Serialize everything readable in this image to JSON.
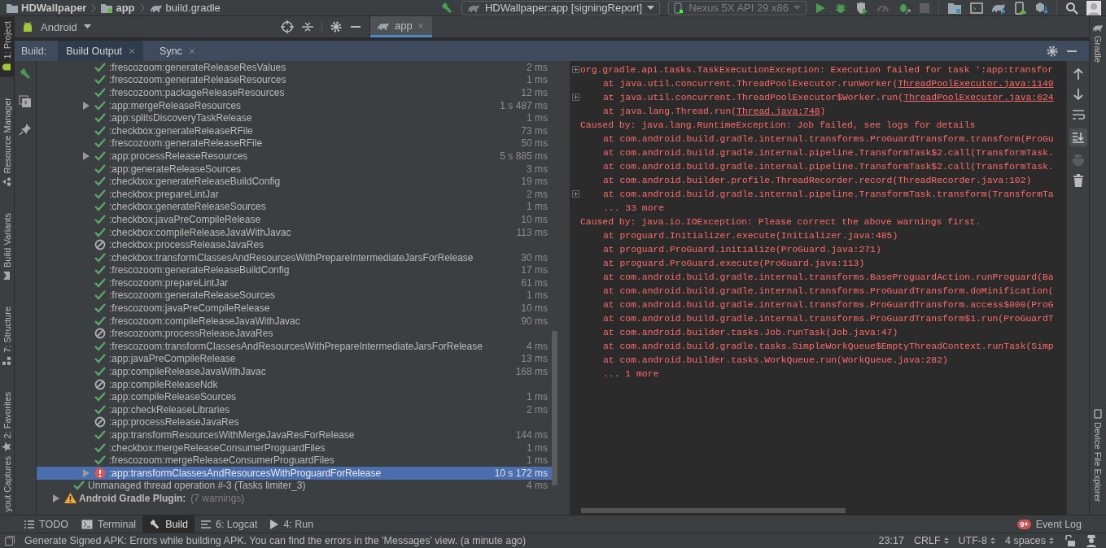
{
  "navbar": {
    "breadcrumbs": [
      {
        "label": "HDWallpaper",
        "kind": "project"
      },
      {
        "label": "app",
        "kind": "module"
      },
      {
        "label": "build.gradle",
        "kind": "file"
      }
    ],
    "run_config": "HDWallpaper:app [signingReport]",
    "device": "Nexus 5X API 29 x86"
  },
  "left_stripe": [
    {
      "label": "1: Project",
      "selected": true
    },
    {
      "label": "Resource Manager",
      "selected": false
    },
    {
      "label": "Build Variants",
      "selected": false
    },
    {
      "label": "7: Structure",
      "selected": false
    },
    {
      "label": "2: Favorites",
      "selected": false
    },
    {
      "label": "yout Captures",
      "selected": false
    }
  ],
  "right_stripe": [
    {
      "label": "Gradle"
    },
    {
      "label": "Device File Explorer"
    }
  ],
  "project_view": {
    "mode": "Android"
  },
  "editor_tabs": [
    {
      "label": "app",
      "selected": true
    }
  ],
  "build_panel": {
    "title": "Build:",
    "tabs": [
      {
        "label": "Build Output",
        "selected": true
      },
      {
        "label": "Sync",
        "selected": false
      }
    ]
  },
  "tree": {
    "tasks": [
      {
        "name": ":frescozoom:generateReleaseResValues",
        "time": "2 ms",
        "kind": "success",
        "expandable": false,
        "selected": false
      },
      {
        "name": ":frescozoom:generateReleaseResources",
        "time": "1 ms",
        "kind": "success",
        "expandable": false,
        "selected": false
      },
      {
        "name": ":frescozoom:packageReleaseResources",
        "time": "12 ms",
        "kind": "success",
        "expandable": false,
        "selected": false
      },
      {
        "name": ":app:mergeReleaseResources",
        "time": "1 s 487 ms",
        "kind": "success",
        "expandable": true,
        "selected": false
      },
      {
        "name": ":app:splitsDiscoveryTaskRelease",
        "time": "1 ms",
        "kind": "success",
        "expandable": false,
        "selected": false
      },
      {
        "name": ":checkbox:generateReleaseRFile",
        "time": "73 ms",
        "kind": "success",
        "expandable": false,
        "selected": false
      },
      {
        "name": ":frescozoom:generateReleaseRFile",
        "time": "50 ms",
        "kind": "success",
        "expandable": false,
        "selected": false
      },
      {
        "name": ":app:processReleaseResources",
        "time": "5 s 885 ms",
        "kind": "success",
        "expandable": true,
        "selected": false
      },
      {
        "name": ":app:generateReleaseSources",
        "time": "3 ms",
        "kind": "success",
        "expandable": false,
        "selected": false
      },
      {
        "name": ":checkbox:generateReleaseBuildConfig",
        "time": "19 ms",
        "kind": "success",
        "expandable": false,
        "selected": false
      },
      {
        "name": ":checkbox:prepareLintJar",
        "time": "2 ms",
        "kind": "success",
        "expandable": false,
        "selected": false
      },
      {
        "name": ":checkbox:generateReleaseSources",
        "time": "1 ms",
        "kind": "success",
        "expandable": false,
        "selected": false
      },
      {
        "name": ":checkbox:javaPreCompileRelease",
        "time": "10 ms",
        "kind": "success",
        "expandable": false,
        "selected": false
      },
      {
        "name": ":checkbox:compileReleaseJavaWithJavac",
        "time": "113 ms",
        "kind": "success",
        "expandable": false,
        "selected": false
      },
      {
        "name": ":checkbox:processReleaseJavaRes",
        "kind": "skipped",
        "expandable": false,
        "selected": false
      },
      {
        "name": ":checkbox:transformClassesAndResourcesWithPrepareIntermediateJarsForRelease",
        "time": "30 ms",
        "kind": "success",
        "expandable": false,
        "selected": false
      },
      {
        "name": ":frescozoom:generateReleaseBuildConfig",
        "time": "17 ms",
        "kind": "success",
        "expandable": false,
        "selected": false
      },
      {
        "name": ":frescozoom:prepareLintJar",
        "time": "61 ms",
        "kind": "success",
        "expandable": false,
        "selected": false
      },
      {
        "name": ":frescozoom:generateReleaseSources",
        "time": "1 ms",
        "kind": "success",
        "expandable": false,
        "selected": false
      },
      {
        "name": ":frescozoom:javaPreCompileRelease",
        "time": "10 ms",
        "kind": "success",
        "expandable": false,
        "selected": false
      },
      {
        "name": ":frescozoom:compileReleaseJavaWithJavac",
        "time": "90 ms",
        "kind": "success",
        "expandable": false,
        "selected": false
      },
      {
        "name": ":frescozoom:processReleaseJavaRes",
        "kind": "skipped",
        "expandable": false,
        "selected": false
      },
      {
        "name": ":frescozoom:transformClassesAndResourcesWithPrepareIntermediateJarsForRelease",
        "time": "4 ms",
        "kind": "success",
        "expandable": false,
        "selected": false
      },
      {
        "name": ":app:javaPreCompileRelease",
        "time": "13 ms",
        "kind": "success",
        "expandable": false,
        "selected": false
      },
      {
        "name": ":app:compileReleaseJavaWithJavac",
        "time": "168 ms",
        "kind": "success",
        "expandable": false,
        "selected": false
      },
      {
        "name": ":app:compileReleaseNdk",
        "kind": "skipped",
        "expandable": false,
        "selected": false
      },
      {
        "name": ":app:compileReleaseSources",
        "time": "1 ms",
        "kind": "success",
        "expandable": false,
        "selected": false
      },
      {
        "name": ":app:checkReleaseLibraries",
        "time": "2 ms",
        "kind": "success",
        "expandable": false,
        "selected": false
      },
      {
        "name": ":app:processReleaseJavaRes",
        "kind": "skipped",
        "expandable": false,
        "selected": false
      },
      {
        "name": ":app:transformResourcesWithMergeJavaResForRelease",
        "time": "144 ms",
        "kind": "success",
        "expandable": false,
        "selected": false
      },
      {
        "name": ":checkbox:mergeReleaseConsumerProguardFiles",
        "time": "1 ms",
        "kind": "success",
        "expandable": false,
        "selected": false
      },
      {
        "name": ":frescozoom:mergeReleaseConsumerProguardFiles",
        "time": "1 ms",
        "kind": "success",
        "expandable": false,
        "selected": false
      },
      {
        "name": ":app:transformClassesAndResourcesWithProguardForRelease",
        "time": "10 s 172 ms",
        "kind": "error",
        "expandable": true,
        "selected": true
      }
    ],
    "thread_row": {
      "name": "Unmanaged thread operation #-3 (Tasks limiter_3)",
      "time": "4 ms",
      "kind": "success"
    },
    "plugin_row": {
      "name": "Android Gradle Plugin:",
      "note": "(7 warnings)",
      "kind": "warning",
      "expandable": true
    }
  },
  "console": [
    {
      "kind": "exception",
      "fold": true,
      "text": "org.gradle.api.tasks.TaskExecutionException: Execution failed for task ':app:transfor"
    },
    {
      "kind": "frame",
      "fold": false,
      "text": "at java.util.concurrent.ThreadPoolExecutor.runWorker(",
      "link": "ThreadPoolExecutor.java:1149"
    },
    {
      "kind": "frame",
      "fold": true,
      "text": "at java.util.concurrent.ThreadPoolExecutor$Worker.run(",
      "link": "ThreadPoolExecutor.java:624"
    },
    {
      "kind": "frame",
      "fold": false,
      "text": "at java.lang.Thread.run(",
      "link": "Thread.java:748",
      "after": ")"
    },
    {
      "kind": "caused",
      "fold": false,
      "text": "Caused by: java.lang.RuntimeException: Job failed, see logs for details"
    },
    {
      "kind": "frame",
      "fold": false,
      "text": "at com.android.build.gradle.internal.transforms.ProGuardTransform.transform(ProGu"
    },
    {
      "kind": "frame",
      "fold": false,
      "text": "at com.android.build.gradle.internal.pipeline.TransformTask$2.call(TransformTask."
    },
    {
      "kind": "frame",
      "fold": false,
      "text": "at com.android.build.gradle.internal.pipeline.TransformTask$2.call(TransformTask."
    },
    {
      "kind": "frame",
      "fold": false,
      "text": "at com.android.builder.profile.ThreadRecorder.record(ThreadRecorder.java:102)"
    },
    {
      "kind": "frame",
      "fold": true,
      "text": "at com.android.build.gradle.internal.pipeline.TransformTask.transform(TransformTa"
    },
    {
      "kind": "more",
      "fold": false,
      "text": "... 33 more"
    },
    {
      "kind": "caused",
      "fold": false,
      "text": "Caused by: java.io.IOException: Please correct the above warnings first."
    },
    {
      "kind": "frame",
      "fold": false,
      "text": "at proguard.Initializer.execute(Initializer.java:485)"
    },
    {
      "kind": "frame",
      "fold": false,
      "text": "at proguard.ProGuard.initialize(ProGuard.java:271)"
    },
    {
      "kind": "frame",
      "fold": false,
      "text": "at proguard.ProGuard.execute(ProGuard.java:113)"
    },
    {
      "kind": "frame",
      "fold": false,
      "text": "at com.android.build.gradle.internal.transforms.BaseProguardAction.runProguard(Ba"
    },
    {
      "kind": "frame",
      "fold": false,
      "text": "at com.android.build.gradle.internal.transforms.ProGuardTransform.doMinification("
    },
    {
      "kind": "frame",
      "fold": false,
      "text": "at com.android.build.gradle.internal.transforms.ProGuardTransform.access$000(ProG"
    },
    {
      "kind": "frame",
      "fold": false,
      "text": "at com.android.build.gradle.internal.transforms.ProGuardTransform$1.run(ProGuardT"
    },
    {
      "kind": "frame",
      "fold": false,
      "text": "at com.android.builder.tasks.Job.runTask(Job.java:47)"
    },
    {
      "kind": "frame",
      "fold": false,
      "text": "at com.android.build.gradle.tasks.SimpleWorkQueue$EmptyThreadContext.runTask(Simp"
    },
    {
      "kind": "frame",
      "fold": false,
      "text": "at com.android.builder.tasks.WorkQueue.run(WorkQueue.java:282)"
    },
    {
      "kind": "more",
      "fold": false,
      "text": "... 1 more"
    }
  ],
  "tool_tabs": [
    {
      "label": "TODO",
      "kind": "list",
      "selected": false
    },
    {
      "label": "Terminal",
      "kind": "terminal",
      "selected": false
    },
    {
      "label": "Build",
      "kind": "hammer",
      "selected": true
    },
    {
      "label": "6: Logcat",
      "kind": "lines",
      "selected": false
    },
    {
      "label": "4: Run",
      "kind": "play",
      "selected": false
    }
  ],
  "event_log": {
    "label": "Event Log",
    "badge": "9+"
  },
  "status_bar": {
    "message": "Generate Signed APK: Errors while building APK. You can find the errors in the 'Messages' view. (a minute ago)",
    "position": "23:17",
    "line_separator": "CRLF",
    "encoding": "UTF-8",
    "indent": "4 spaces"
  }
}
